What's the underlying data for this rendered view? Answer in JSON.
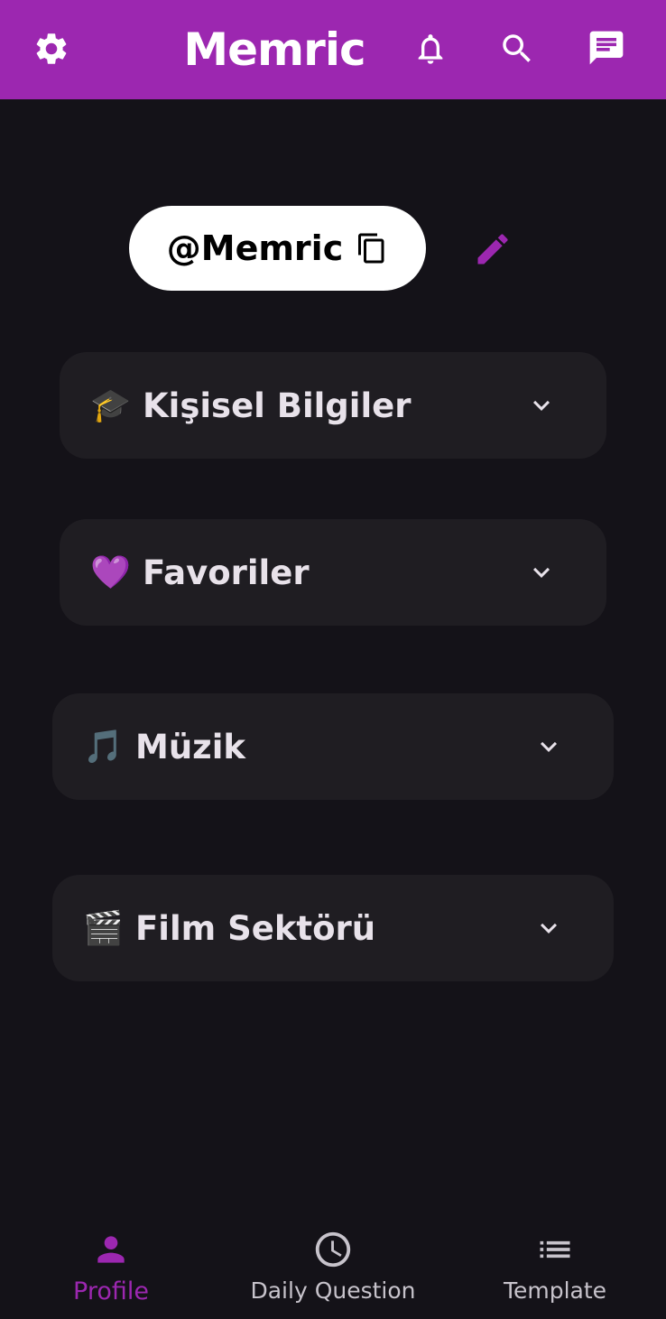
{
  "appbar": {
    "title": "Memric",
    "settings_icon": "gear-icon",
    "notifications_icon": "bell-icon",
    "search_icon": "search-icon",
    "messages_icon": "chat-icon",
    "color": "#9c27b0"
  },
  "profile": {
    "handle": "@Memric",
    "copy_icon": "copy-icon",
    "edit_icon": "pencil-icon"
  },
  "sections": [
    {
      "emoji": "🎓",
      "label": "Kişisel Bilgiler"
    },
    {
      "emoji": "💜",
      "label": "Favoriler"
    },
    {
      "emoji": "🎵",
      "label": "Müzik"
    },
    {
      "emoji": "🎬",
      "label": "Film Sektörü"
    }
  ],
  "bottom_nav": [
    {
      "label": "Profile",
      "icon": "person-icon",
      "active": true
    },
    {
      "label": "Daily Question",
      "icon": "clock-icon",
      "active": false
    },
    {
      "label": "Template",
      "icon": "list-icon",
      "active": false
    }
  ],
  "colors": {
    "accent": "#9c27b0",
    "background": "#141218",
    "card": "#1f1d22"
  }
}
